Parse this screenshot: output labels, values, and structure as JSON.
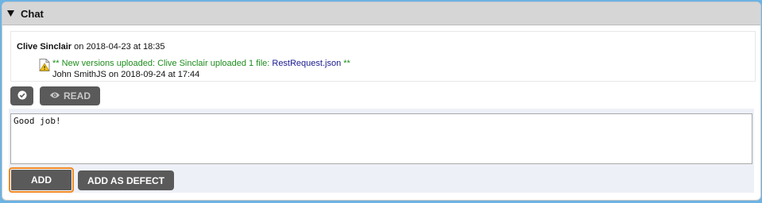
{
  "panel": {
    "title": "Chat",
    "toggle_icon": "triangle-down-icon"
  },
  "message": {
    "author": "Clive Sinclair",
    "meta": " on 2018-04-23 at 18:35",
    "attachment": {
      "icon": "document-warning-icon",
      "prefix": "** New versions uploaded: Clive Sinclair uploaded 1 file: ",
      "filename": "RestRequest.json",
      "suffix": " **",
      "meta": "John SmithJS on 2018-09-24 at 17:44"
    }
  },
  "actions": {
    "check_icon": "check-circle-icon",
    "read_icon": "eye-icon",
    "read_label": "READ"
  },
  "compose": {
    "value": "Good job!",
    "add_label": "ADD",
    "defect_label": "ADD AS DEFECT"
  },
  "colors": {
    "page_background": "#6db3e3",
    "header_background": "#d6d6d6",
    "button": "#5a5a5a",
    "focus_outline": "#f08a24",
    "activity_text": "#1c8d1c",
    "file_link": "#1a1a8e"
  }
}
